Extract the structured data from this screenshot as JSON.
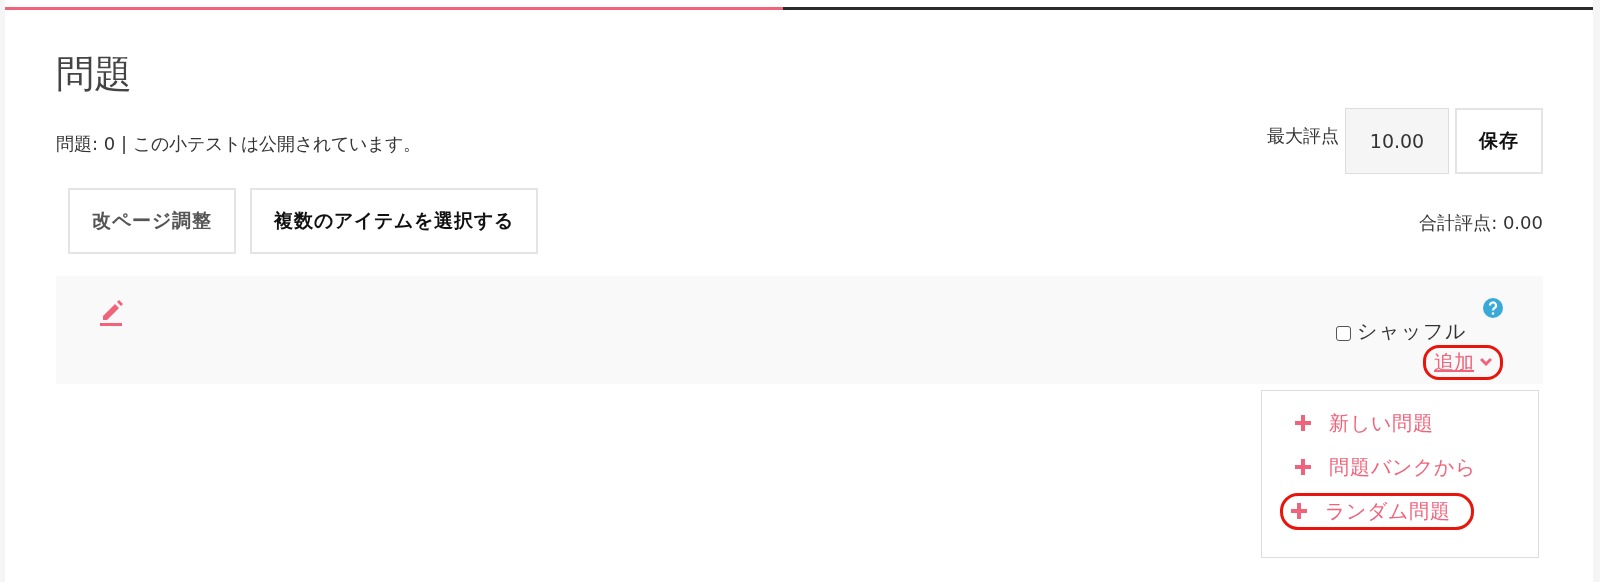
{
  "progress": {
    "level": 0.49
  },
  "heading": "問題",
  "status": "問題: 0 | この小テストは公開されています。",
  "max_grade": {
    "label": "最大評点",
    "value": "10.00",
    "button": "保存"
  },
  "buttons": [
    "改ページ調整",
    "複数のアイテムを選択する"
  ],
  "total": "合計評点: 0.00",
  "section": {
    "shuffle": {
      "label": "シャッフル",
      "checked": false
    },
    "add": {
      "label": "追加",
      "highlighted": true,
      "expanded": true
    },
    "menu": [
      {
        "label": "新しい問題",
        "highlighted": false
      },
      {
        "label": "問題バンクから",
        "highlighted": false
      },
      {
        "label": "ランダム問題",
        "highlighted": true
      }
    ]
  }
}
